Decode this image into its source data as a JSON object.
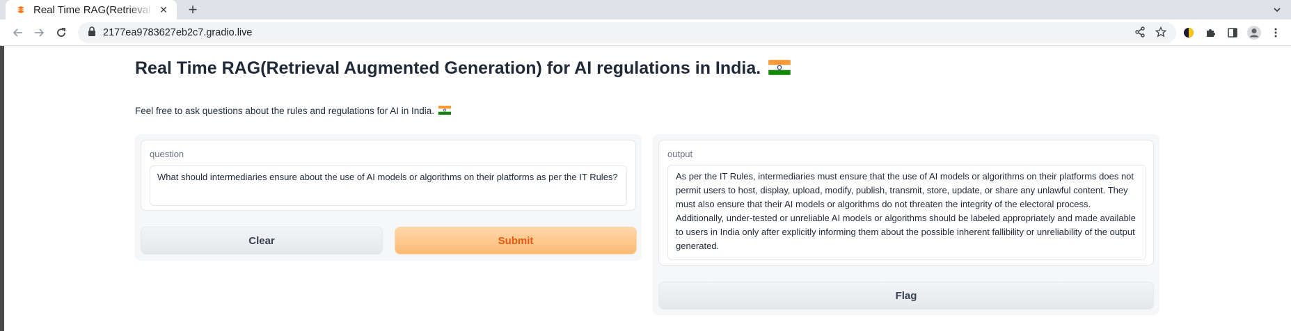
{
  "browser": {
    "tab": {
      "title": "Real Time RAG(Retrieval Augmented Generation) for AI regulations in India. 🇮🇳"
    },
    "address_bar": {
      "url": "2177ea9783627eb2c7.gradio.live"
    }
  },
  "page": {
    "title": "Real Time RAG(Retrieval Augmented Generation) for AI regulations in India.",
    "description": "Feel free to ask questions about the rules and regulations for AI in India."
  },
  "input_panel": {
    "question_label": "question",
    "question_value": "What should intermediaries ensure about the use of AI models or algorithms on their platforms as per the IT Rules?",
    "clear_label": "Clear",
    "submit_label": "Submit"
  },
  "output_panel": {
    "output_label": "output",
    "output_value": "As per the IT Rules, intermediaries must ensure that the use of AI models or algorithms on their platforms does not permit users to host, display, upload, modify, publish, transmit, store, update, or share any unlawful content. They must also ensure that their AI models or algorithms do not threaten the integrity of the electoral process. Additionally, under-tested or unreliable AI models or algorithms should be labeled appropriately and made available to users in India only after explicitly informing them about the possible inherent fallibility or unreliability of the output generated.",
    "flag_label": "Flag"
  },
  "colors": {
    "primary_button_text": "#ea580c",
    "primary_button_bg": "#fdba74",
    "flag_saffron": "#ff9933",
    "flag_green": "#138808",
    "flag_chakra": "#000080"
  }
}
